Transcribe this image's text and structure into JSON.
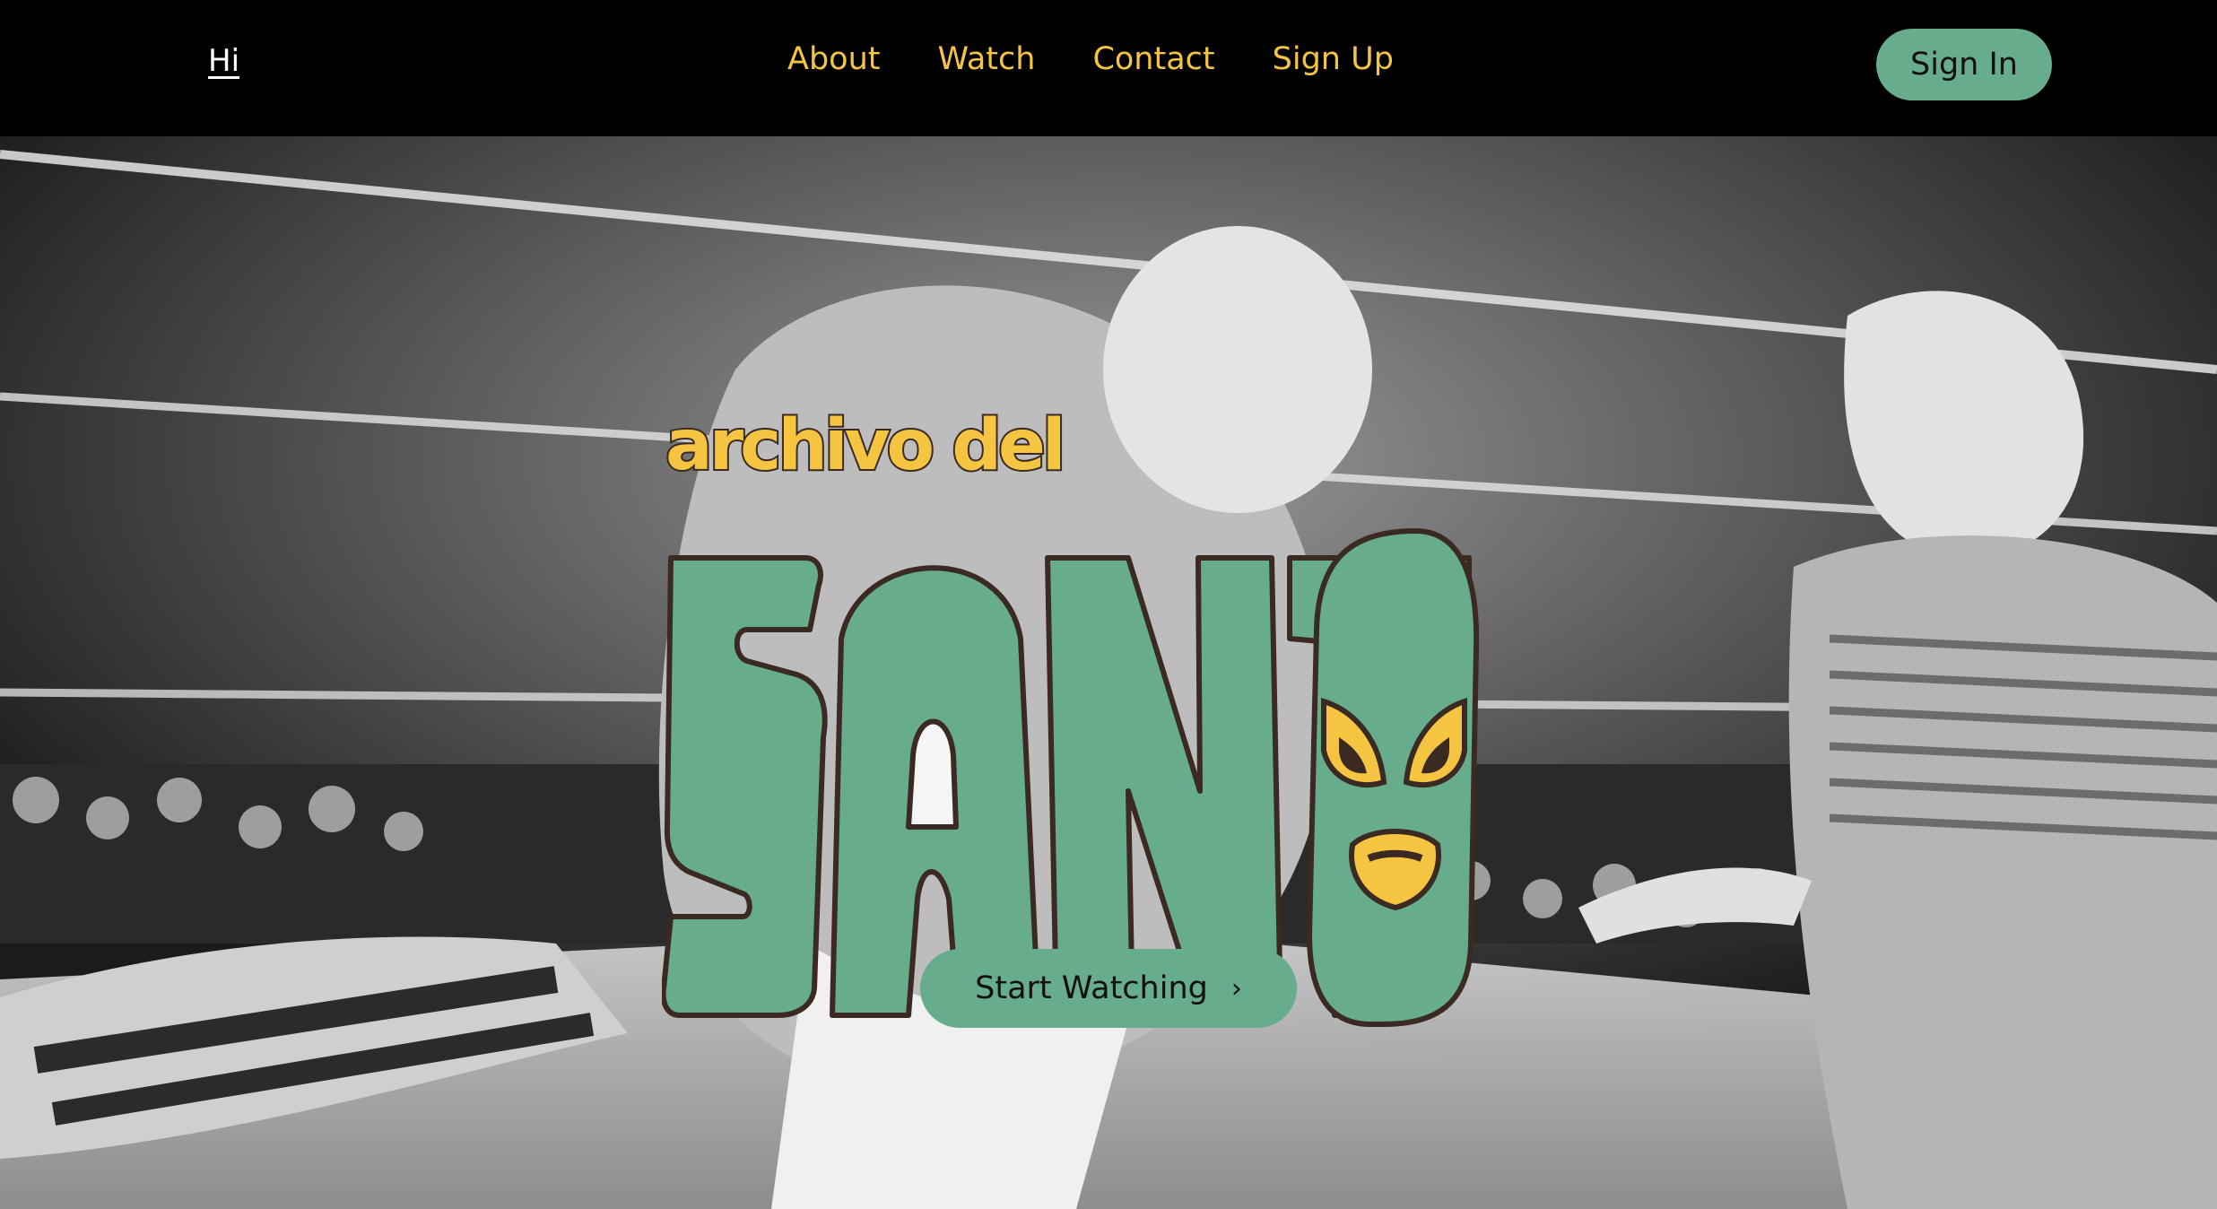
{
  "header": {
    "brand": "Hi",
    "nav": [
      "About",
      "Watch",
      "Contact",
      "Sign Up"
    ],
    "signin_label": "Sign In"
  },
  "hero": {
    "logo_kicker": "archivo del",
    "logo_title": "SANTO",
    "cta_label": "Start Watching",
    "cta_icon": "chevron-right-icon"
  },
  "colors": {
    "accent_green": "#67ac8c",
    "accent_yellow": "#f5c542",
    "header_bg": "#000000",
    "outline_brown": "#3a2a22"
  }
}
